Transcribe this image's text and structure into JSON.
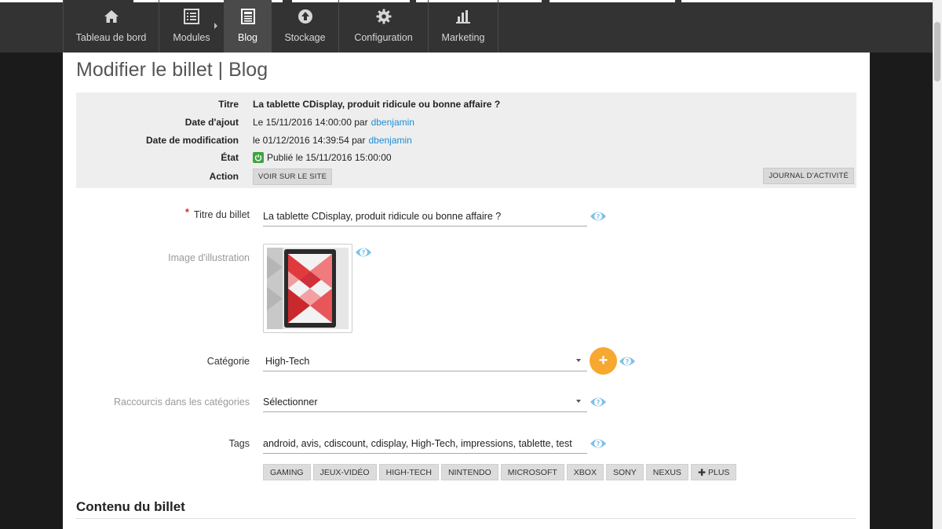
{
  "nav": {
    "items": [
      {
        "label": "Tableau de bord",
        "icon": "home-icon"
      },
      {
        "label": "Modules",
        "icon": "modules-icon"
      },
      {
        "label": "Blog",
        "icon": "blog-icon",
        "active": true
      },
      {
        "label": "Stockage",
        "icon": "upload-icon"
      },
      {
        "label": "Configuration",
        "icon": "gear-icon"
      },
      {
        "label": "Marketing",
        "icon": "bar-chart-icon"
      }
    ]
  },
  "page": {
    "title": "Modifier le billet | Blog"
  },
  "meta": {
    "titre_label": "Titre",
    "titre_value": "La tablette CDisplay, produit ridicule ou bonne affaire ?",
    "date_ajout_label": "Date d'ajout",
    "date_ajout_value": "Le 15/11/2016 14:00:00 par",
    "date_ajout_user": "dbenjamin",
    "date_modif_label": "Date de modification",
    "date_modif_value": "le 01/12/2016 14:39:54 par",
    "date_modif_user": "dbenjamin",
    "etat_label": "État",
    "etat_value": "Publié le 15/11/2016 15:00:00",
    "action_label": "Action",
    "voir_button": "VOIR SUR LE SITE",
    "journal_button": "JOURNAL D'ACTIVITÉ"
  },
  "form": {
    "titre_label": "Titre du billet",
    "titre_required": "*",
    "titre_value": "La tablette CDisplay, produit ridicule ou bonne affaire ?",
    "image_label": "Image d'illustration",
    "categorie_label": "Catégorie",
    "categorie_value": "High-Tech",
    "add_symbol": "+",
    "raccourcis_label": "Raccourcis dans les catégories",
    "raccourcis_value": "Sélectionner",
    "tags_label": "Tags",
    "tags_value": "android, avis, cdiscount, cdisplay, High-Tech, impressions, tablette, test",
    "tag_buttons": [
      "GAMING",
      "JEUX-VIDÉO",
      "HIGH-TECH",
      "NINTENDO",
      "MICROSOFT",
      "XBOX",
      "SONY",
      "NEXUS"
    ],
    "plus_button": "PLUS"
  },
  "content": {
    "section_title": "Contenu du billet"
  },
  "colors": {
    "nav_bg": "#333333",
    "nav_active": "#4a4a4a",
    "link": "#1a8fd6",
    "accent_orange": "#f7a830",
    "help_blue": "#7cc0e8",
    "status_green": "#3fa33f"
  }
}
